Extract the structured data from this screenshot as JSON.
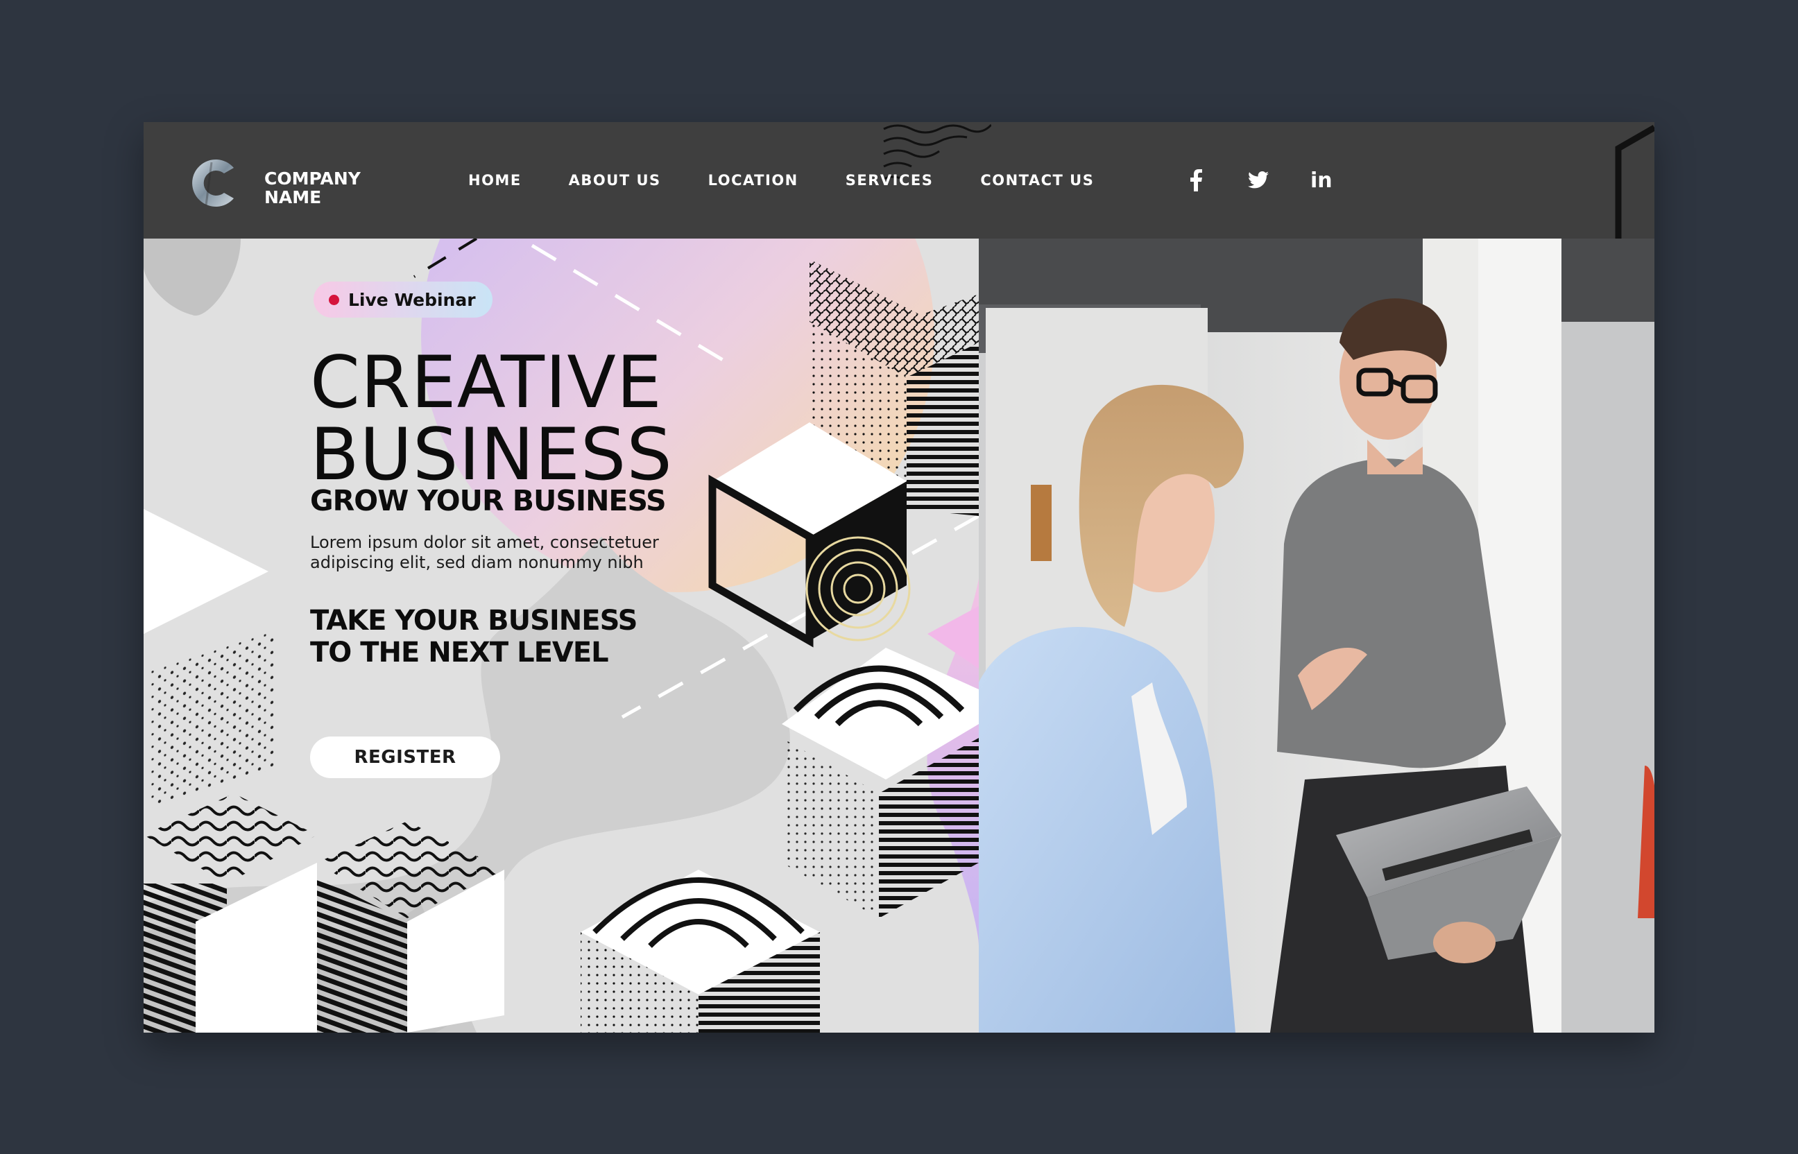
{
  "brand": {
    "line1": "COMPANY",
    "line2": "NAME",
    "logo_icon": "c-letter-logo-icon"
  },
  "nav": {
    "items": [
      {
        "label": "HOME"
      },
      {
        "label": "ABOUT US"
      },
      {
        "label": "LOCATION"
      },
      {
        "label": "SERVICES"
      },
      {
        "label": "CONTACT US"
      }
    ]
  },
  "social": {
    "facebook_icon": "facebook-icon",
    "twitter_icon": "twitter-icon",
    "linkedin_label": "in"
  },
  "hero": {
    "badge": "Live Webinar",
    "title_line1": "CREATIVE",
    "title_line2": "BUSINESS",
    "subtitle": "GROW YOUR BUSINESS",
    "body": "Lorem ipsum dolor sit amet, consectetuer adipiscing elit, sed diam nonummy nibh",
    "tagline_line1": "TAKE YOUR BUSINESS",
    "tagline_line2": "TO THE NEXT LEVEL",
    "cta": "REGISTER"
  },
  "colors": {
    "page_bg": "#2e3540",
    "navbar_bg": "#3f3f3f",
    "hero_bg": "#e0e0e0",
    "badge_dot": "#d5143c",
    "gradient_purple": "#d2c4f4",
    "gradient_peach": "#f4dcae"
  },
  "photo": {
    "description_icon": "team-photo"
  }
}
